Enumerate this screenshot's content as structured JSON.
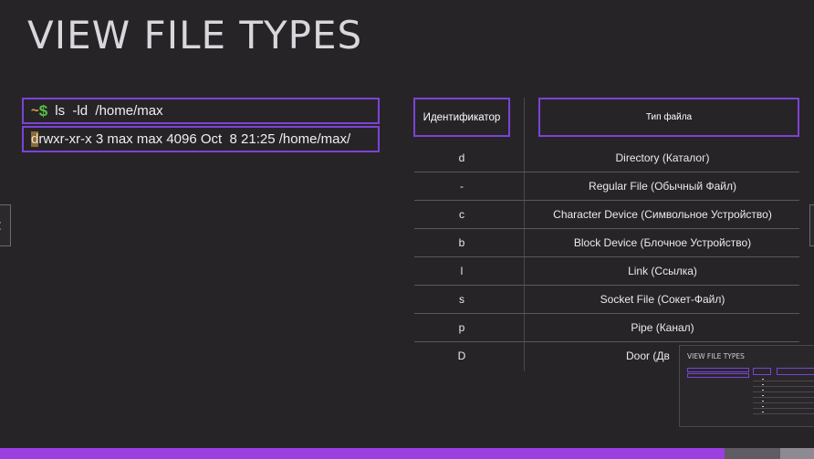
{
  "slide": {
    "title": "VIEW FILE TYPES"
  },
  "terminal": {
    "prompt_tilde": "~",
    "prompt_dollar": "$",
    "command": "ls  -ld  /home/max",
    "output_cursor_char": "d",
    "output_rest": "rwxr-xr-x 3 max max 4096 Oct  8 21:25 /home/max/"
  },
  "table": {
    "headers": [
      "Идентификатор",
      "Тип файла"
    ],
    "rows": [
      {
        "id": "d",
        "type": "Directory (Каталог)"
      },
      {
        "id": "-",
        "type": "Regular File (Обычный Файл)"
      },
      {
        "id": "c",
        "type": "Character Device (Символьное Устройство)"
      },
      {
        "id": "b",
        "type": "Block Device (Блочное Устройство)"
      },
      {
        "id": "l",
        "type": "Link (Ссылка)"
      },
      {
        "id": "s",
        "type": "Socket File (Сокет-Файл)"
      },
      {
        "id": "p",
        "type": "Pipe (Канал)"
      },
      {
        "id": "D",
        "type": "Door (Дв"
      }
    ]
  },
  "navigation": {
    "prev_icon": "chevron-left-icon",
    "prev_glyph": "‹",
    "next_icon": "chevron-right-icon"
  },
  "pip": {
    "title": "VIEW FILE TYPES"
  },
  "progress": {
    "value_percent": 89
  },
  "colors": {
    "background": "#272428",
    "accent": "#7b43d6",
    "progress_bar": "#9b3fe0",
    "prompt_tilde": "#d9a83a",
    "prompt_dollar": "#55c145"
  }
}
